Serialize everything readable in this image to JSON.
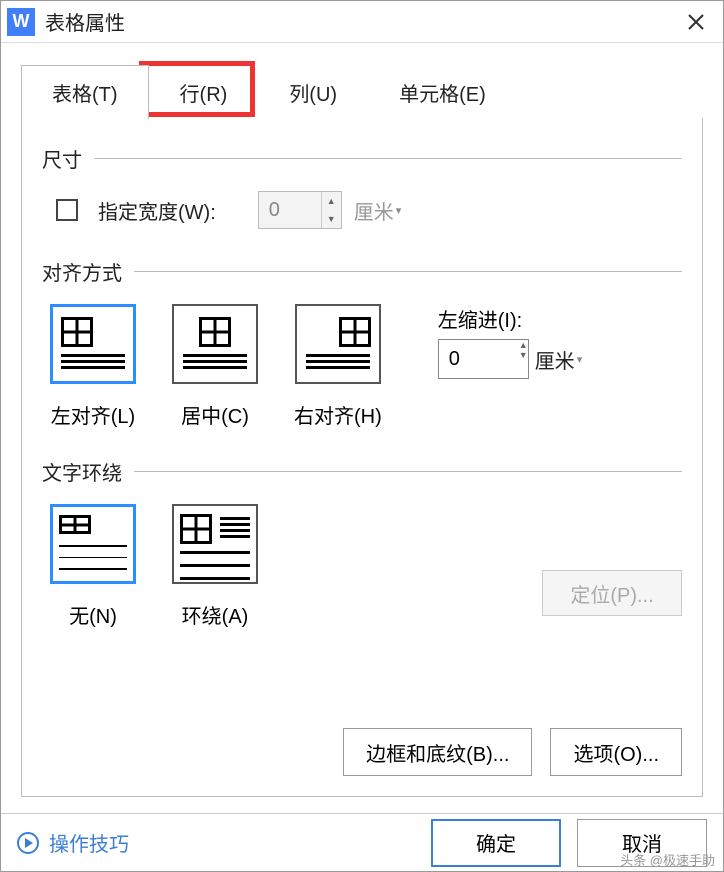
{
  "window": {
    "title": "表格属性",
    "app_icon_letter": "W"
  },
  "tabs": {
    "table": "表格(T)",
    "row": "行(R)",
    "column": "列(U)",
    "cell": "单元格(E)",
    "active": "table",
    "highlighted": "row"
  },
  "sections": {
    "size": {
      "title": "尺寸",
      "specify_width_label": "指定宽度(W):",
      "width_value": "0",
      "unit": "厘米"
    },
    "alignment": {
      "title": "对齐方式",
      "left": "左对齐(L)",
      "center": "居中(C)",
      "right": "右对齐(H)",
      "indent_label": "左缩进(I):",
      "indent_value": "0",
      "indent_unit": "厘米"
    },
    "wrap": {
      "title": "文字环绕",
      "none": "无(N)",
      "around": "环绕(A)"
    }
  },
  "buttons": {
    "position": "定位(P)...",
    "borders": "边框和底纹(B)...",
    "options": "选项(O)...",
    "ok": "确定",
    "cancel": "取消"
  },
  "footer": {
    "link": "操作技巧"
  },
  "watermark": "头条 @极速手助"
}
